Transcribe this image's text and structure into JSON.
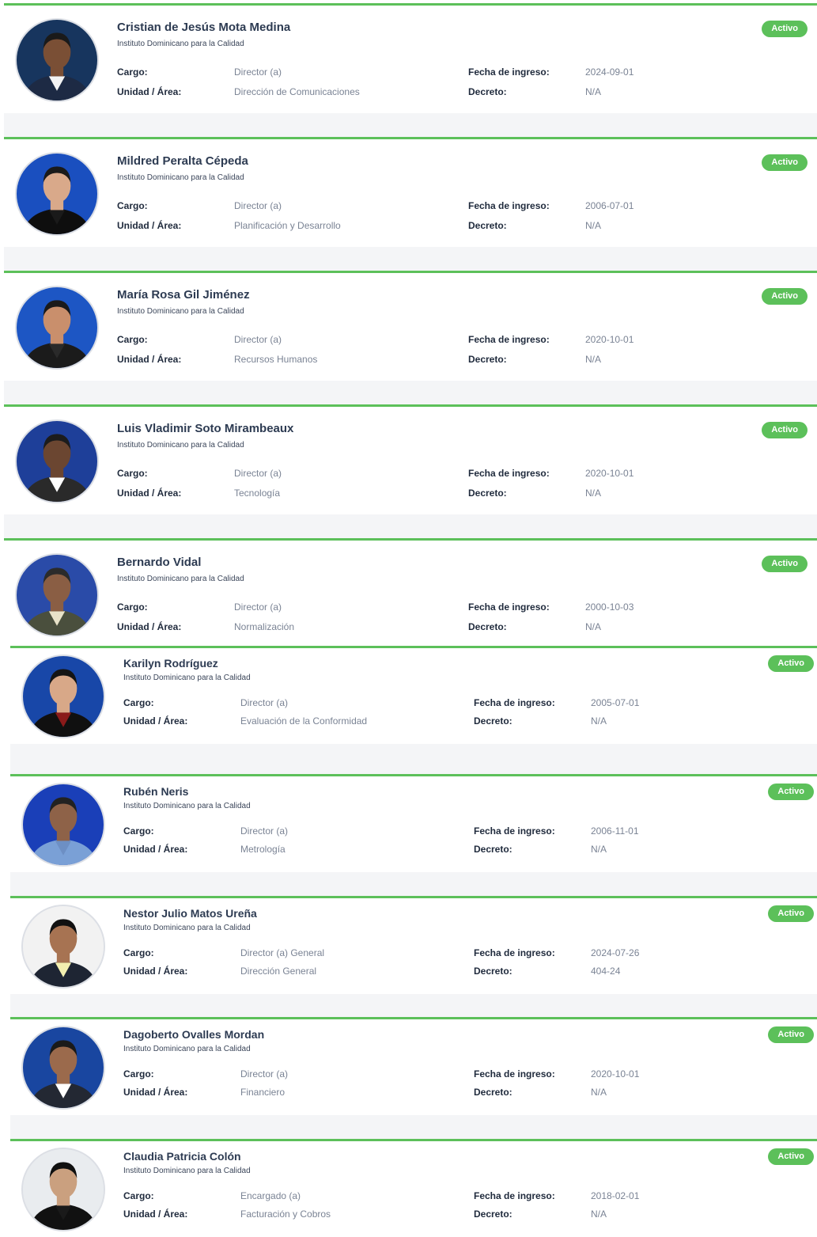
{
  "labels": {
    "cargo": "Cargo:",
    "unidad": "Unidad / Área:",
    "fecha": "Fecha de ingreso:",
    "decreto": "Decreto:"
  },
  "people": [
    {
      "name": "Cristian de Jesús Mota Medina",
      "org": "Instituto Dominicano para la Calidad",
      "cargo": "Director (a)",
      "unidad": "Dirección de Comunicaciones",
      "fecha": "2024-09-01",
      "decreto": "N/A",
      "status": "Activo"
    },
    {
      "name": "Mildred Peralta Cépeda",
      "org": "Instituto Dominicano para la Calidad",
      "cargo": "Director (a)",
      "unidad": "Planificación y Desarrollo",
      "fecha": "2006-07-01",
      "decreto": "N/A",
      "status": "Activo"
    },
    {
      "name": "María Rosa Gil Jiménez",
      "org": "Instituto Dominicano para la Calidad",
      "cargo": "Director (a)",
      "unidad": "Recursos Humanos",
      "fecha": "2020-10-01",
      "decreto": "N/A",
      "status": "Activo"
    },
    {
      "name": "Luis Vladimir Soto Mirambeaux",
      "org": "Instituto Dominicano para la Calidad",
      "cargo": "Director (a)",
      "unidad": "Tecnología",
      "fecha": "2020-10-01",
      "decreto": "N/A",
      "status": "Activo"
    },
    {
      "name": "Bernardo Vidal",
      "org": "Instituto Dominicano para la Calidad",
      "cargo": "Director (a)",
      "unidad": "Normalización",
      "fecha": "2000-10-03",
      "decreto": "N/A",
      "status": "Activo"
    },
    {
      "name": "Karilyn Rodríguez",
      "org": "Instituto Dominicano para la Calidad",
      "cargo": "Director (a)",
      "unidad": "Evaluación de la Conformidad",
      "fecha": "2005-07-01",
      "decreto": "N/A",
      "status": "Activo"
    },
    {
      "name": "Rubén Neris",
      "org": "Instituto Dominicano para la Calidad",
      "cargo": "Director (a)",
      "unidad": "Metrología",
      "fecha": "2006-11-01",
      "decreto": "N/A",
      "status": "Activo"
    },
    {
      "name": "Nestor Julio Matos Ureña",
      "org": "Instituto Dominicano para la Calidad",
      "cargo": "Director (a) General",
      "unidad": "Dirección General",
      "fecha": "2024-07-26",
      "decreto": "404-24",
      "status": "Activo"
    },
    {
      "name": "Dagoberto Ovalles Mordan",
      "org": "Instituto Dominicano para la Calidad",
      "cargo": "Director (a)",
      "unidad": "Financiero",
      "fecha": "2020-10-01",
      "decreto": "N/A",
      "status": "Activo"
    },
    {
      "name": "Claudia Patricia Colón",
      "org": "Instituto Dominicano para la Calidad",
      "cargo": "Encargado (a)",
      "unidad": "Facturación y Cobros",
      "fecha": "2018-02-01",
      "decreto": "N/A",
      "status": "Activo"
    }
  ],
  "colors": {
    "accent": "#5cc05a",
    "gap": "#f4f5f7",
    "photo_backgrounds": [
      "#17355e",
      "#1a4fbf",
      "#1d56c4",
      "#1e3f99",
      "#2a4ba8",
      "#1847a8",
      "#1a3fb8",
      "#f2f2f2",
      "#1946a0",
      "#e9ecef"
    ]
  }
}
